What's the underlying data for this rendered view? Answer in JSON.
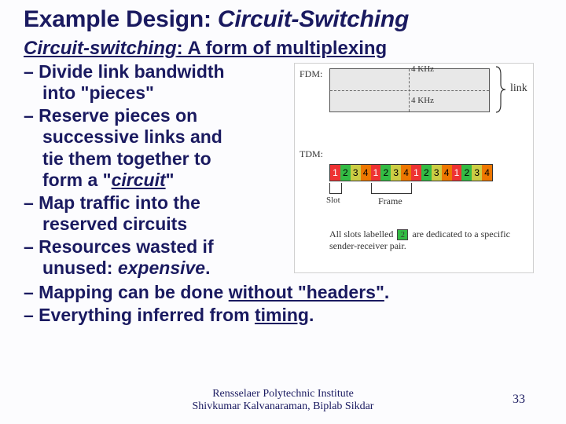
{
  "title_a": "Example Design: ",
  "title_b": "Circuit-Switching",
  "subhead_a": "Circuit-switching",
  "subhead_b": ": A form of multiplexing",
  "bullets_left": {
    "b1a": "– Divide link bandwidth",
    "b1b": "into \"pieces\"",
    "b2a": "– Reserve pieces on",
    "b2b": "successive links and",
    "b2c": "tie them together to",
    "b2d_pre": "form a \"",
    "b2d_it": "circuit",
    "b2d_post": "\"",
    "b3a": "– Map traffic into the",
    "b3b": "reserved circuits",
    "b4a": "– Resources wasted if",
    "b4b_pre": "unused: ",
    "b4b_it": "expensive"
  },
  "bullets_bottom": {
    "b5_pre": "– Mapping can be done ",
    "b5_u": "without \"headers\"",
    "b5_post": ".",
    "b6_pre": "– Everything inferred from ",
    "b6_u": "timing",
    "b6_post": "."
  },
  "diagram": {
    "fdm": "FDM:",
    "tdm": "TDM:",
    "khz": "4 KHz",
    "link": "link",
    "slot": "Slot",
    "frame": "Frame",
    "caption_a": "All slots labelled ",
    "caption_b": " are dedicated to a specific sender-receiver pair.",
    "n1": "1",
    "n2": "2",
    "n3": "3",
    "n4": "4"
  },
  "footer": {
    "l1": "Rensselaer Polytechnic Institute",
    "l2": "Shivkumar Kalvanaraman, Biplab Sikdar"
  },
  "page": "33"
}
